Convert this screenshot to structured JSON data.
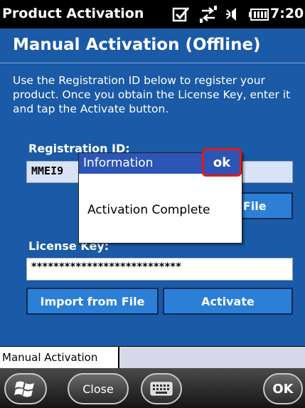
{
  "status_bar": {
    "title": "Product Activation",
    "time": "7:20",
    "icons": [
      "notification-check-icon",
      "connectivity-icon",
      "volume-icon",
      "battery-icon"
    ]
  },
  "page": {
    "title": "Manual Activation (Offline)",
    "instructions": "Use the Registration ID below to register your product. Once you obtain the License Key, enter it and tap the Activate button.",
    "registration_label": "Registration ID:",
    "registration_value": "MMEI9",
    "save_to_file_label": "Save to File",
    "license_label": "License Key:",
    "license_value": "***************************",
    "import_button": "Import from File",
    "activate_button": "Activate"
  },
  "dialog": {
    "title": "Information",
    "ok_label": "ok",
    "message": "Activation Complete"
  },
  "tabs": [
    {
      "label": "Manual Activation"
    }
  ],
  "softkeys": {
    "close_label": "Close",
    "ok_label": "OK"
  },
  "colors": {
    "background": "#1a5aa6",
    "button": "#2b7fd6",
    "dialog_header": "#2c55b5",
    "highlight": "#e21a1a"
  }
}
